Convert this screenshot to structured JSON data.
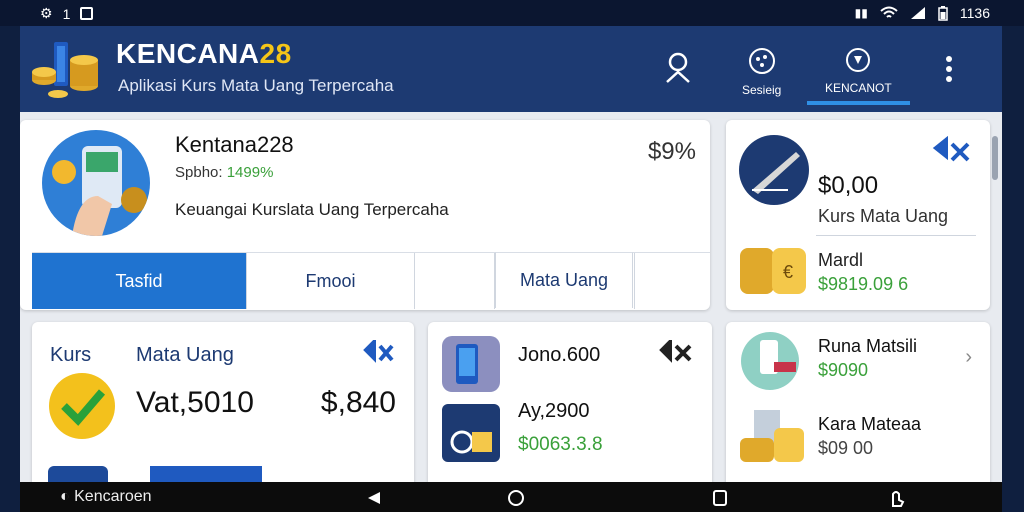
{
  "status_bar": {
    "left_text": "1",
    "time": "1136",
    "battery_icon": "battery-icon",
    "wifi_icon": "wifi-icon",
    "signal_icon": "signal-icon"
  },
  "header": {
    "brand_main": "KENCANA",
    "brand_num": "28",
    "tagline": "Aplikasi Kurs Mata Uang Terpercaha",
    "icons": [
      {
        "name": "profile-icon",
        "label": ""
      },
      {
        "name": "settings-icon",
        "label": "Sesieig"
      },
      {
        "name": "kencana-icon",
        "label": "KENCANOT"
      },
      {
        "name": "more-icon",
        "label": ""
      }
    ]
  },
  "profile_card": {
    "name": "Kentana228",
    "sub_label": "Spbho:",
    "sub_value": "1499%",
    "description": "Keuangai Kurslata Uang Terpercaha",
    "percent": "$9%",
    "tabs": [
      "Tasfid",
      "Fmooi",
      "",
      "",
      "Mata Uang",
      ""
    ]
  },
  "right_card": {
    "value": "$0,00",
    "subtitle": "Kurs Mata Uang",
    "item_name": "Mardl",
    "item_value": "$9819.09 6"
  },
  "card_kurs": {
    "label_left": "Kurs",
    "label_right": "Mata Uang",
    "value_left": "Vat,5010",
    "value_right": "$,840"
  },
  "card_jono": {
    "item1_name": "Jono.600",
    "item2_name": "Ay,2900",
    "item2_value": "$0063.3.8"
  },
  "card_runa": {
    "item1_name": "Runa Matsili",
    "item1_value": "$9090",
    "item2_name": "Kara Mateaa",
    "item2_value": "$09 00"
  },
  "nav_bar": {
    "brand": "Kencaroen"
  },
  "colors": {
    "header": "#1d3a72",
    "accent_blue": "#1f73d0",
    "gold": "#f5c518",
    "green": "#3aa03a"
  }
}
